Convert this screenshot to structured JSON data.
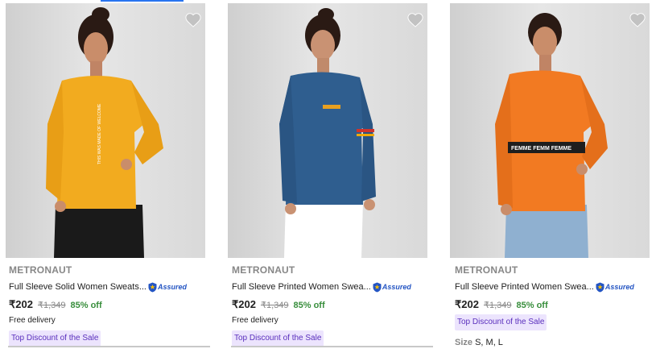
{
  "products": [
    {
      "brand": "METRONAUT",
      "title": "Full Sleeve Solid Women Sweats...",
      "assured_label": "Assured",
      "price": "₹202",
      "mrp": "₹1,349",
      "discount": "85% off",
      "delivery": "Free delivery",
      "badge": "Top Discount of the Sale",
      "shirt_color": "#f2ab1f",
      "print_text": "THIS WAS MADE OF WELCOME"
    },
    {
      "brand": "METRONAUT",
      "title": "Full Sleeve Printed Women Swea...",
      "assured_label": "Assured",
      "price": "₹202",
      "mrp": "₹1,349",
      "discount": "85% off",
      "delivery": "Free delivery",
      "badge": "Top Discount of the Sale",
      "shirt_color": "#2f5e8f"
    },
    {
      "brand": "METRONAUT",
      "title": "Full Sleeve Printed Women Swea...",
      "assured_label": "Assured",
      "price": "₹202",
      "mrp": "₹1,349",
      "discount": "85% off",
      "badge": "Top Discount of the Sale",
      "size_label": "Size",
      "size_values": "S, M, L",
      "shirt_color": "#f27a22",
      "print_text": "FEMME FEMM FEMME"
    }
  ],
  "colors": {
    "accent": "#2874f0",
    "discount_green": "#388e3c",
    "badge_bg": "#ece4fd",
    "badge_text": "#5a2fbd",
    "assured_blue": "#2455c3"
  },
  "icons": {
    "wishlist": "heart-icon",
    "assured": "assured-shield-icon"
  }
}
